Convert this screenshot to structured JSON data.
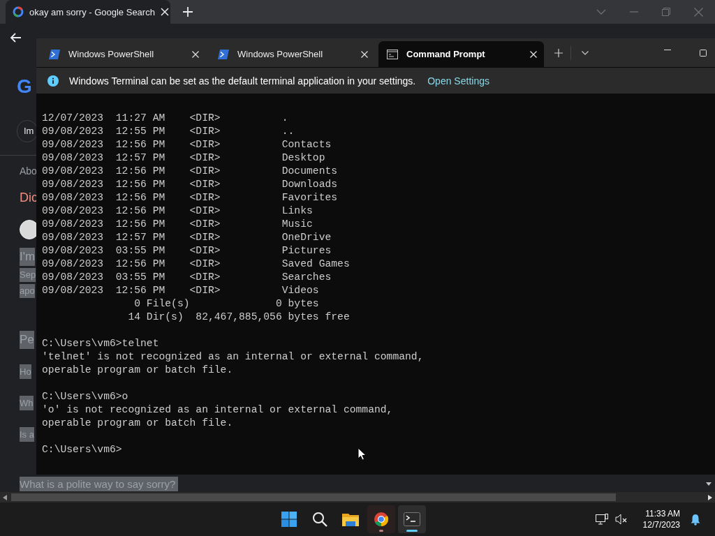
{
  "browser": {
    "tab": {
      "title": "okay am sorry - Google Search"
    },
    "fragments": [
      {
        "kind": "logo",
        "text": "G"
      },
      {
        "kind": "chip",
        "text": "Im"
      },
      {
        "kind": "meta",
        "text": "Abo"
      },
      {
        "kind": "heading",
        "text": "Dic"
      },
      {
        "kind": "avatar"
      },
      {
        "kind": "large",
        "text": "I'm"
      },
      {
        "kind": "small",
        "text": "Sep"
      },
      {
        "kind": "small",
        "text": "apo"
      },
      {
        "kind": "large",
        "text": "Pe"
      },
      {
        "kind": "question",
        "text": "Ho"
      },
      {
        "kind": "question",
        "text": "Wh"
      },
      {
        "kind": "question",
        "text": "Is a"
      },
      {
        "kind": "question",
        "text": "What is a polite way to say sorry?"
      }
    ]
  },
  "terminal": {
    "tabs": [
      {
        "kind": "powershell",
        "title": "Windows PowerShell",
        "selected": false
      },
      {
        "kind": "powershell",
        "title": "Windows PowerShell",
        "selected": false
      },
      {
        "kind": "cmd",
        "title": "Command Prompt",
        "selected": true
      }
    ],
    "infobar": {
      "message": "Windows Terminal can be set as the default terminal application in your settings.",
      "link": "Open Settings"
    },
    "blocks": [
      [
        "12/07/2023  11:27 AM    <DIR>          .",
        "09/08/2023  12:55 PM    <DIR>          ..",
        "09/08/2023  12:56 PM    <DIR>          Contacts",
        "09/08/2023  12:57 PM    <DIR>          Desktop",
        "09/08/2023  12:56 PM    <DIR>          Documents",
        "09/08/2023  12:56 PM    <DIR>          Downloads",
        "09/08/2023  12:56 PM    <DIR>          Favorites",
        "09/08/2023  12:56 PM    <DIR>          Links",
        "09/08/2023  12:56 PM    <DIR>          Music",
        "09/08/2023  12:57 PM    <DIR>          OneDrive",
        "09/08/2023  03:55 PM    <DIR>          Pictures",
        "09/08/2023  12:56 PM    <DIR>          Saved Games",
        "09/08/2023  03:55 PM    <DIR>          Searches",
        "09/08/2023  12:56 PM    <DIR>          Videos",
        "               0 File(s)              0 bytes",
        "              14 Dir(s)  82,467,885,056 bytes free"
      ],
      [
        "C:\\Users\\vm6>telnet",
        "'telnet' is not recognized as an internal or external command,",
        "operable program or batch file."
      ],
      [
        "C:\\Users\\vm6>o",
        "'o' is not recognized as an internal or external command,",
        "operable program or batch file."
      ],
      [
        "C:\\Users\\vm6>"
      ]
    ]
  },
  "taskbar": {
    "apps": [
      {
        "kind": "start",
        "running": false,
        "active": false
      },
      {
        "kind": "search",
        "running": false,
        "active": false
      },
      {
        "kind": "folder",
        "running": false,
        "active": false
      },
      {
        "kind": "chrome",
        "running": true,
        "active": false
      },
      {
        "kind": "terminal",
        "running": true,
        "active": true
      }
    ],
    "time": "11:33 AM",
    "date": "12/7/2023"
  }
}
